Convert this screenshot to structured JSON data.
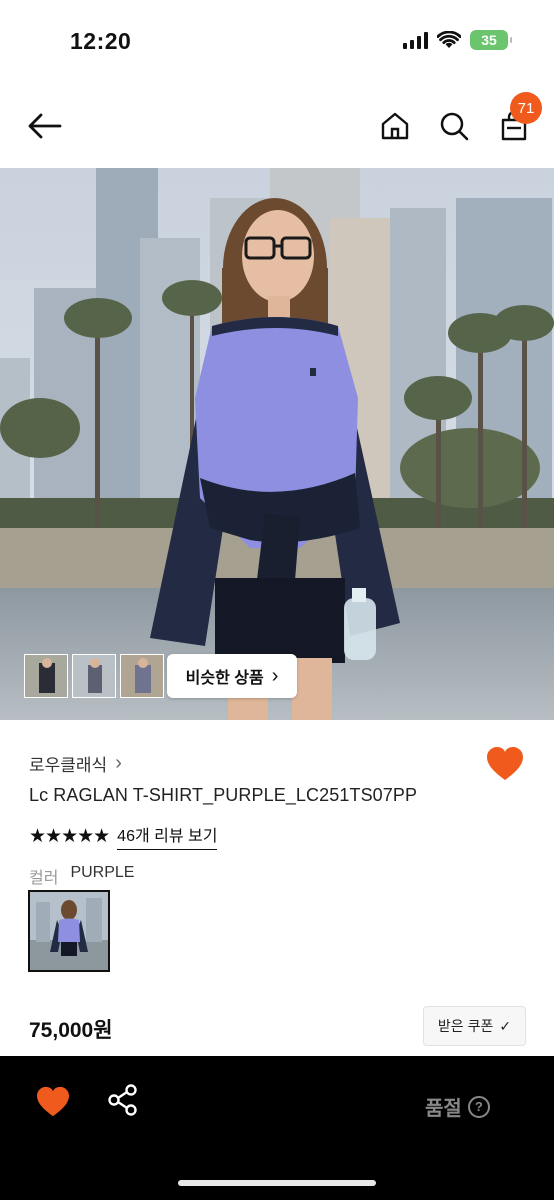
{
  "status_bar": {
    "time": "12:20",
    "battery": "35"
  },
  "nav": {
    "cart_count": "71"
  },
  "hero": {
    "similar_label": "비슷한 상품",
    "similar_chevron": "›"
  },
  "product": {
    "brand": "로우클래식",
    "brand_chevron": "›",
    "name": "Lc RAGLAN T-SHIRT_PURPLE_LC251TS07PP",
    "rating_stars": "★★★★★",
    "review_link": "46개 리뷰 보기",
    "color_label": "컬러",
    "color_value": "PURPLE",
    "price": "75,000원",
    "coupon_label": "받은 쿠폰",
    "coupon_check": "✓"
  },
  "bottom_bar": {
    "status_label": "품절",
    "help_glyph": "?"
  },
  "icons": {
    "back": "arrow-left-icon",
    "home": "home-icon",
    "search": "search-icon",
    "cart": "shopping-bag-icon",
    "like": "heart-icon",
    "share": "share-icon"
  },
  "colors": {
    "accent": "#f05a1c",
    "shirt": "#8e8fe0",
    "sleeve": "#232a45",
    "bottom_bar": "#000000"
  }
}
